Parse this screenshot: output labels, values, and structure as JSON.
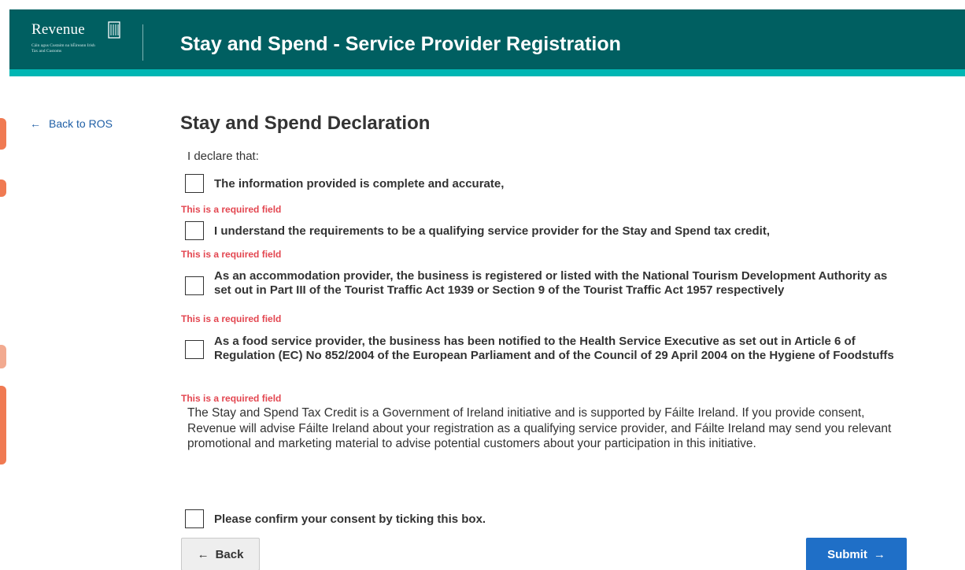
{
  "header": {
    "logo_word": "Revenue",
    "logo_sub": "Cáin agus Custaim na hÉireann Irish Tax and Customs",
    "title": "Stay and Spend - Service Provider Registration"
  },
  "nav": {
    "back_to_ros": "Back to ROS"
  },
  "main": {
    "title": "Stay and Spend Declaration",
    "intro": "I declare that:",
    "declarations": [
      {
        "label": "The information provided is complete and accurate,",
        "checked": false,
        "error": "This is a required field"
      },
      {
        "label": "I understand the requirements to be a qualifying service provider for the Stay and Spend tax credit,",
        "checked": false,
        "error": "This is a required field"
      },
      {
        "label": "As an accommodation provider, the business is registered or listed with the National Tourism Development Authority as set out in Part III of the Tourist Traffic Act 1939 or Section 9 of the Tourist Traffic Act 1957 respectively",
        "checked": false,
        "error": "This is a required field"
      },
      {
        "label": "As a food service provider, the business has been notified to the Health Service Executive as set out in Article 6 of Regulation (EC) No 852/2004 of the European Parliament and of the Council of 29 April 2004 on the Hygiene of Foodstuffs",
        "checked": false,
        "error": "This is a required field"
      }
    ],
    "consent_text": "The Stay and Spend Tax Credit is a Government of Ireland initiative and is supported by Fáilte Ireland. If you provide consent, Revenue will advise Fáilte Ireland about your registration as a qualifying service provider, and Fáilte Ireland may send you relevant promotional and marketing material to advise potential customers about your participation in this initiative.",
    "consent_checkbox": {
      "label": "Please confirm your consent by ticking this box.",
      "checked": false
    }
  },
  "actions": {
    "back_label": "Back",
    "submit_label": "Submit"
  },
  "colors": {
    "header_bg": "#005f61",
    "header_stripe": "#00b6b3",
    "link": "#1f5fa6",
    "error": "#e34650",
    "submit_bg": "#1f6fc7"
  }
}
